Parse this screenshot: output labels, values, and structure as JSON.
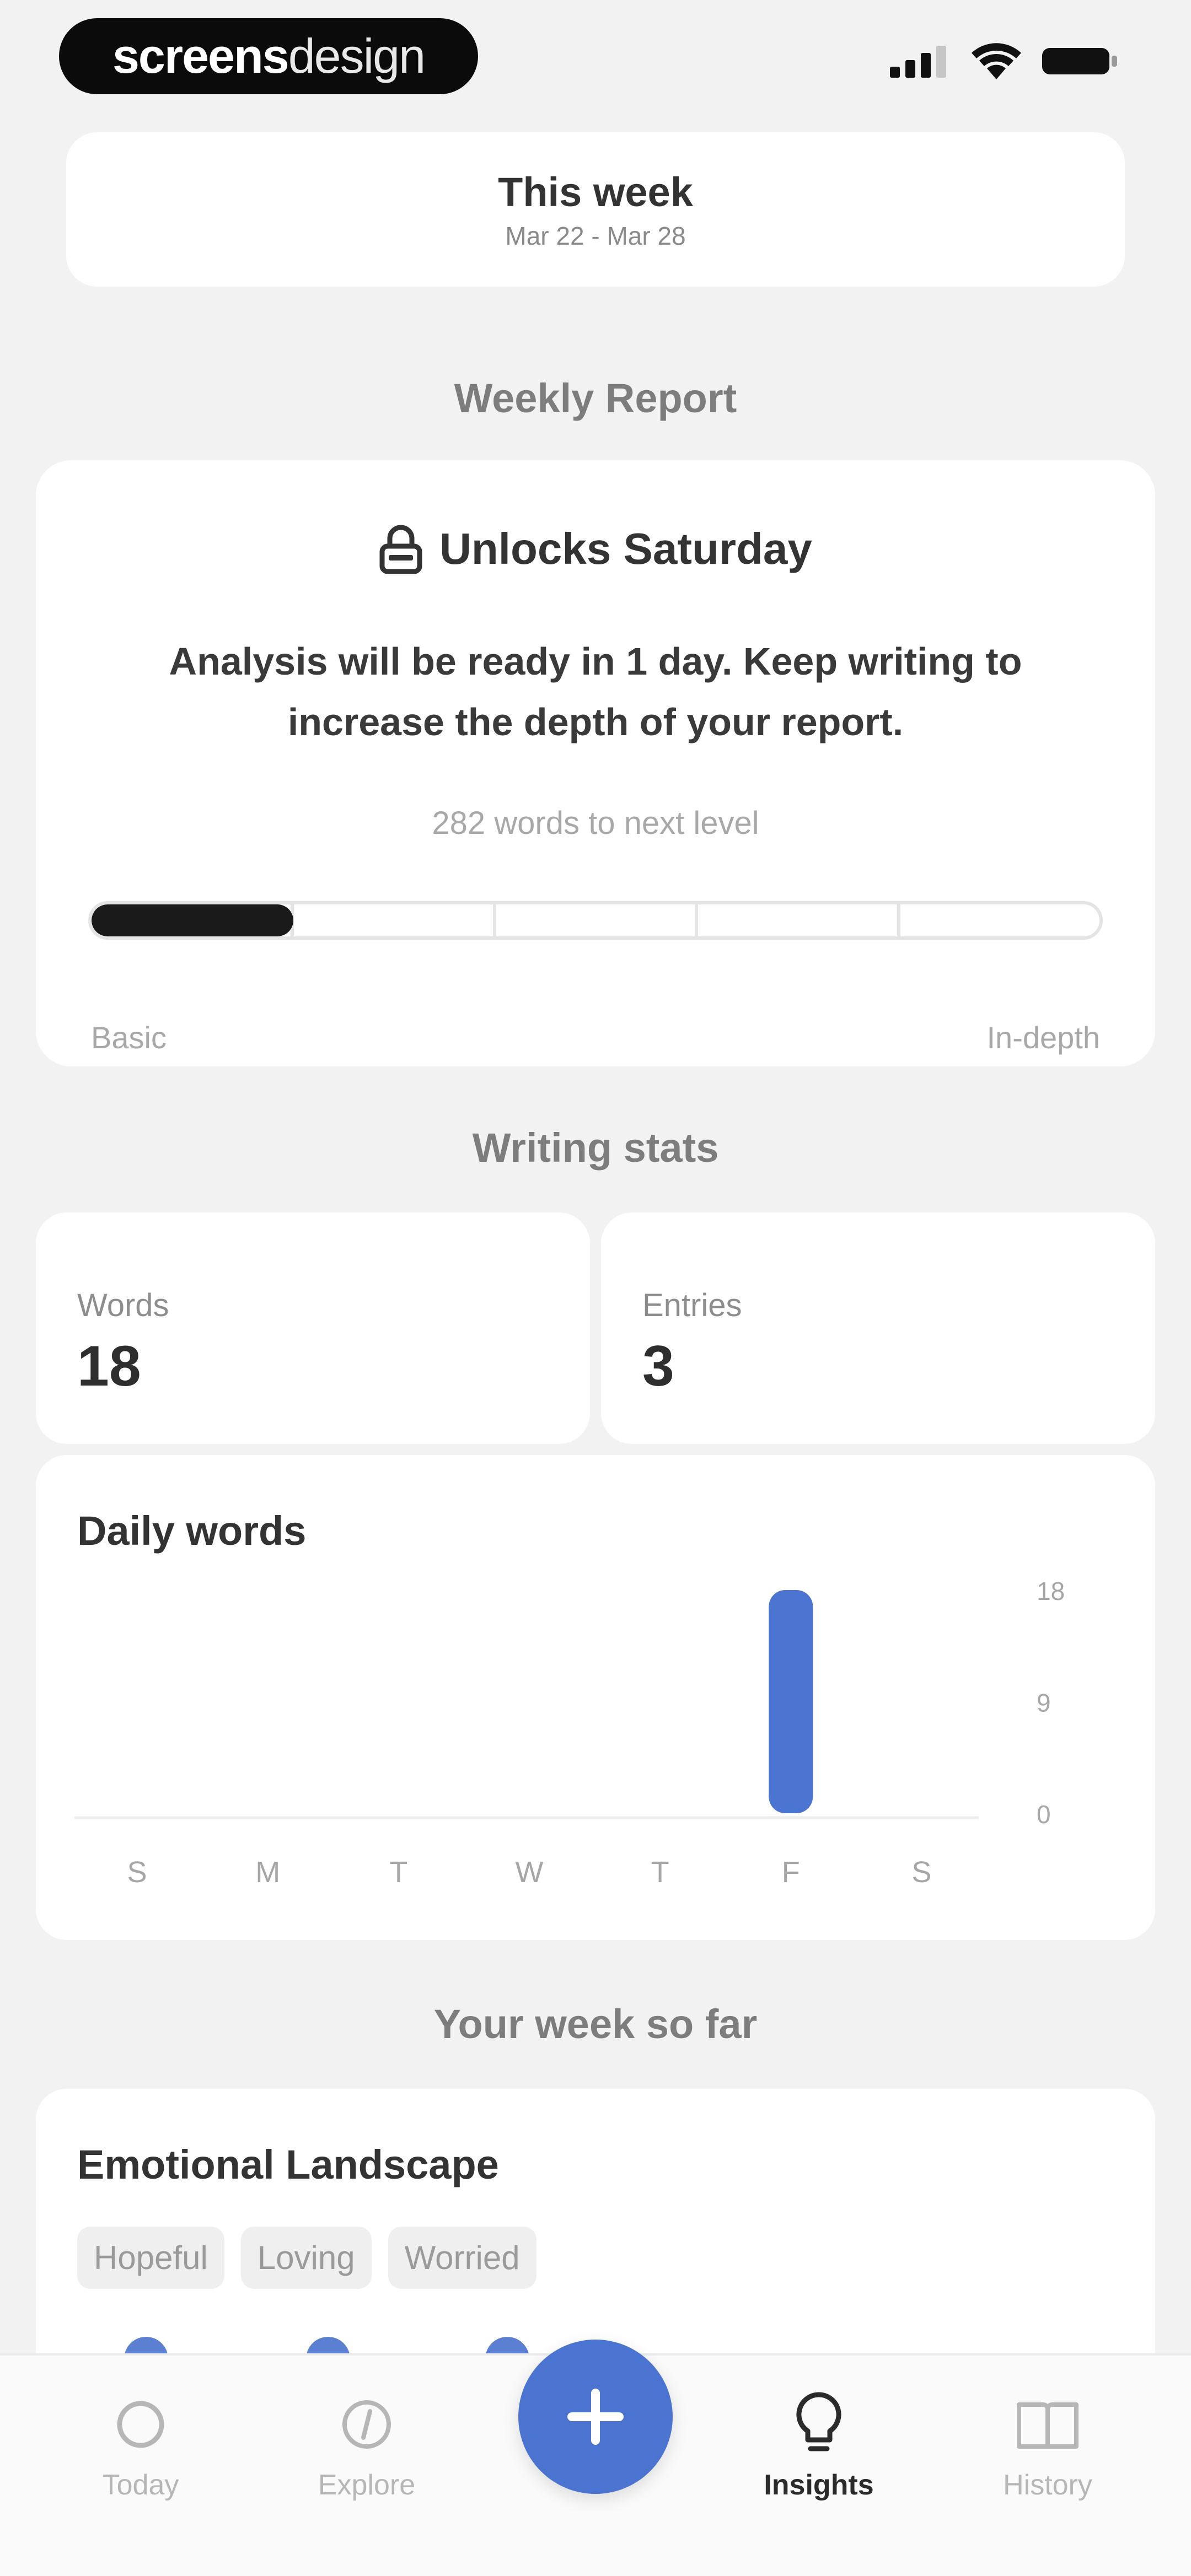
{
  "brand": {
    "part1": "screens",
    "part2": "design"
  },
  "status_bar": {
    "icons": [
      "signal-icon",
      "wifi-icon",
      "battery-icon"
    ]
  },
  "week": {
    "title": "This week",
    "range": "Mar 22 - Mar 28"
  },
  "sections": {
    "weekly_report": "Weekly Report",
    "writing_stats": "Writing stats",
    "your_week": "Your week so far"
  },
  "report": {
    "unlock_title": "Unlocks Saturday",
    "description": "Analysis will be ready in 1 day. Keep writing to increase the depth of your report.",
    "words_to_next": "282 words to next level",
    "progress_level": 0.2,
    "progress_segments": 5,
    "label_left": "Basic",
    "label_right": "In-depth"
  },
  "stats": {
    "words_label": "Words",
    "words_value": "18",
    "entries_label": "Entries",
    "entries_value": "3"
  },
  "chart_data": {
    "type": "bar",
    "title": "Daily words",
    "categories": [
      "S",
      "M",
      "T",
      "W",
      "T",
      "F",
      "S"
    ],
    "values": [
      0,
      0,
      0,
      0,
      0,
      18,
      0
    ],
    "yticks": [
      "18",
      "9",
      "0"
    ],
    "ylim": [
      0,
      18
    ],
    "grid": false,
    "color": "#4a74d0"
  },
  "emotions": {
    "title": "Emotional Landscape",
    "chips": [
      "Hopeful",
      "Loving",
      "Worried"
    ]
  },
  "tabs": [
    {
      "label": "Today",
      "icon": "circle-icon"
    },
    {
      "label": "Explore",
      "icon": "compass-icon"
    },
    {
      "label": "Insights",
      "icon": "lightbulb-icon",
      "active": true
    },
    {
      "label": "History",
      "icon": "book-icon"
    }
  ],
  "colors": {
    "accent": "#4a74d0",
    "background": "#f2f2f2"
  }
}
